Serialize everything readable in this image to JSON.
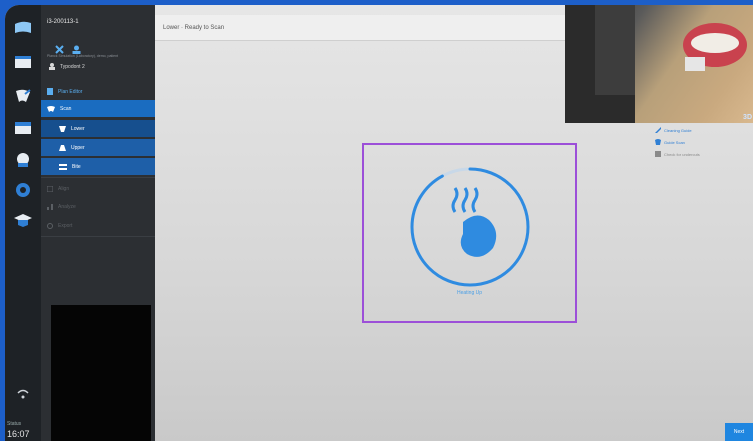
{
  "case": {
    "id": "i3-200113-1",
    "tiny_text": "Planck Simulation (Laboratory), demo, patient",
    "patient": "Typodont 2"
  },
  "nav": {
    "plan_editor": "Plan Editor",
    "scan": "Scan",
    "lower": "Lower",
    "upper": "Upper",
    "bite": "Bite",
    "align": "Align",
    "analyze": "Analyze",
    "export": "Export"
  },
  "status": {
    "text": "Lower · Ready to Scan"
  },
  "actions": [
    {
      "label": "Cleaning Guide"
    },
    {
      "label": "Guide Scan"
    },
    {
      "label": "Check for undercuts"
    }
  ],
  "scanner": {
    "state_label": "Heating Up",
    "progress_fraction": 0.92
  },
  "rail": {
    "status_line": "Status",
    "time": "16:07"
  },
  "buttons": {
    "next": "Next"
  },
  "camera": {
    "label": "3D"
  },
  "colors": {
    "accent": "#1a6cc0",
    "selection": "#9c4fd8",
    "ring": "#2f8be0"
  }
}
